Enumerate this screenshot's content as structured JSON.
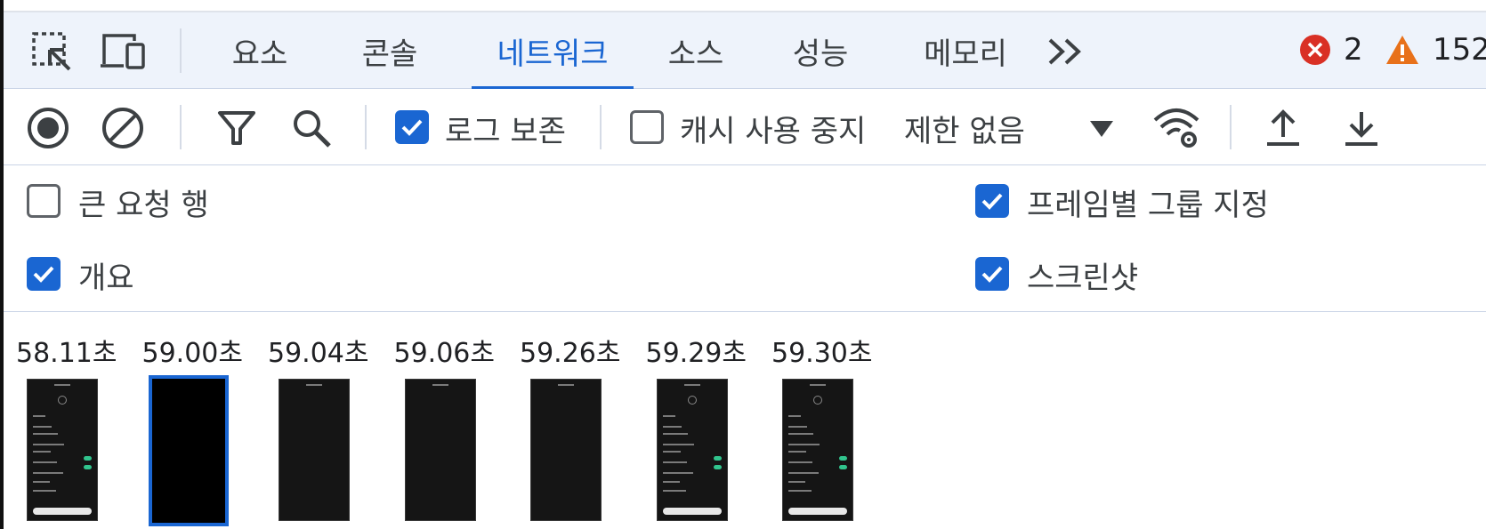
{
  "tabs": [
    {
      "label": "요소",
      "active": false
    },
    {
      "label": "콘솔",
      "active": false
    },
    {
      "label": "네트워크",
      "active": true
    },
    {
      "label": "소스",
      "active": false
    },
    {
      "label": "성능",
      "active": false
    },
    {
      "label": "메모리",
      "active": false
    }
  ],
  "status": {
    "errors": "2",
    "warnings": "152"
  },
  "toolbar": {
    "preserve_log_label": "로그 보존",
    "disable_cache_label": "캐시 사용 중지",
    "throttling_value": "제한 없음"
  },
  "options": {
    "large_rows_label": "큰 요청 행",
    "overview_label": "개요",
    "group_by_frame_label": "프레임별 그룹 지정",
    "screenshots_label": "스크린샷"
  },
  "filmstrip": [
    {
      "time": "58.11초",
      "kind": "settings"
    },
    {
      "time": "59.00초",
      "kind": "black",
      "selected": true
    },
    {
      "time": "59.04초",
      "kind": "blank"
    },
    {
      "time": "59.06초",
      "kind": "header"
    },
    {
      "time": "59.26초",
      "kind": "header"
    },
    {
      "time": "59.29초",
      "kind": "settings"
    },
    {
      "time": "59.30초",
      "kind": "settings"
    }
  ],
  "colors": {
    "accent": "#1a66d2",
    "error": "#d93025",
    "warning": "#e8711a"
  }
}
